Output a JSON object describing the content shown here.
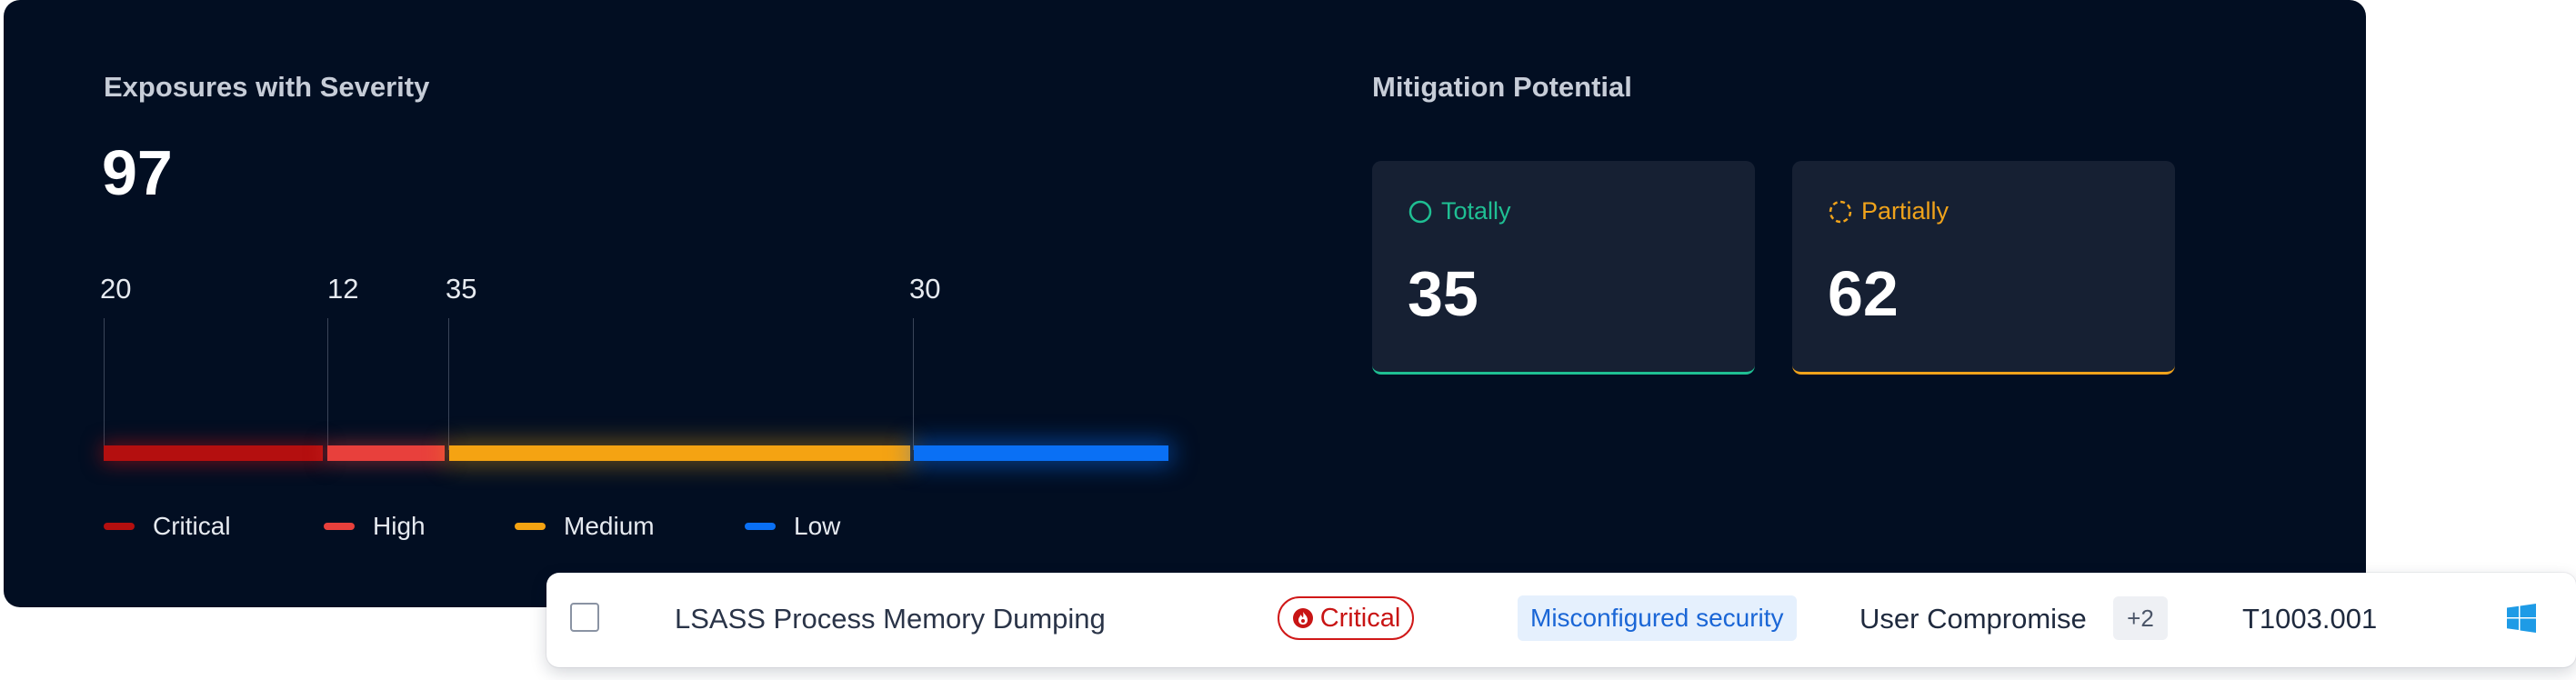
{
  "exposures": {
    "title": "Exposures with Severity",
    "total": "97",
    "segments": [
      {
        "label": "Critical",
        "value": "20",
        "color": "#b40f0f"
      },
      {
        "label": "High",
        "value": "12",
        "color": "#e8403c"
      },
      {
        "label": "Medium",
        "value": "35",
        "color": "#f5a312"
      },
      {
        "label": "Low",
        "value": "30",
        "color": "#0a70f5"
      }
    ]
  },
  "mitigation": {
    "title": "Mitigation Potential",
    "totally": {
      "label": "Totally",
      "value": "35",
      "color": "#1fbf93"
    },
    "partially": {
      "label": "Partially",
      "value": "62",
      "color": "#f0a31b"
    }
  },
  "row": {
    "title": "LSASS Process Memory Dumping",
    "severity": "Critical",
    "tag": "Misconfigured security",
    "category": "User Compromise",
    "more": "+2",
    "technique": "T1003.001",
    "os_icon": "windows-icon"
  }
}
